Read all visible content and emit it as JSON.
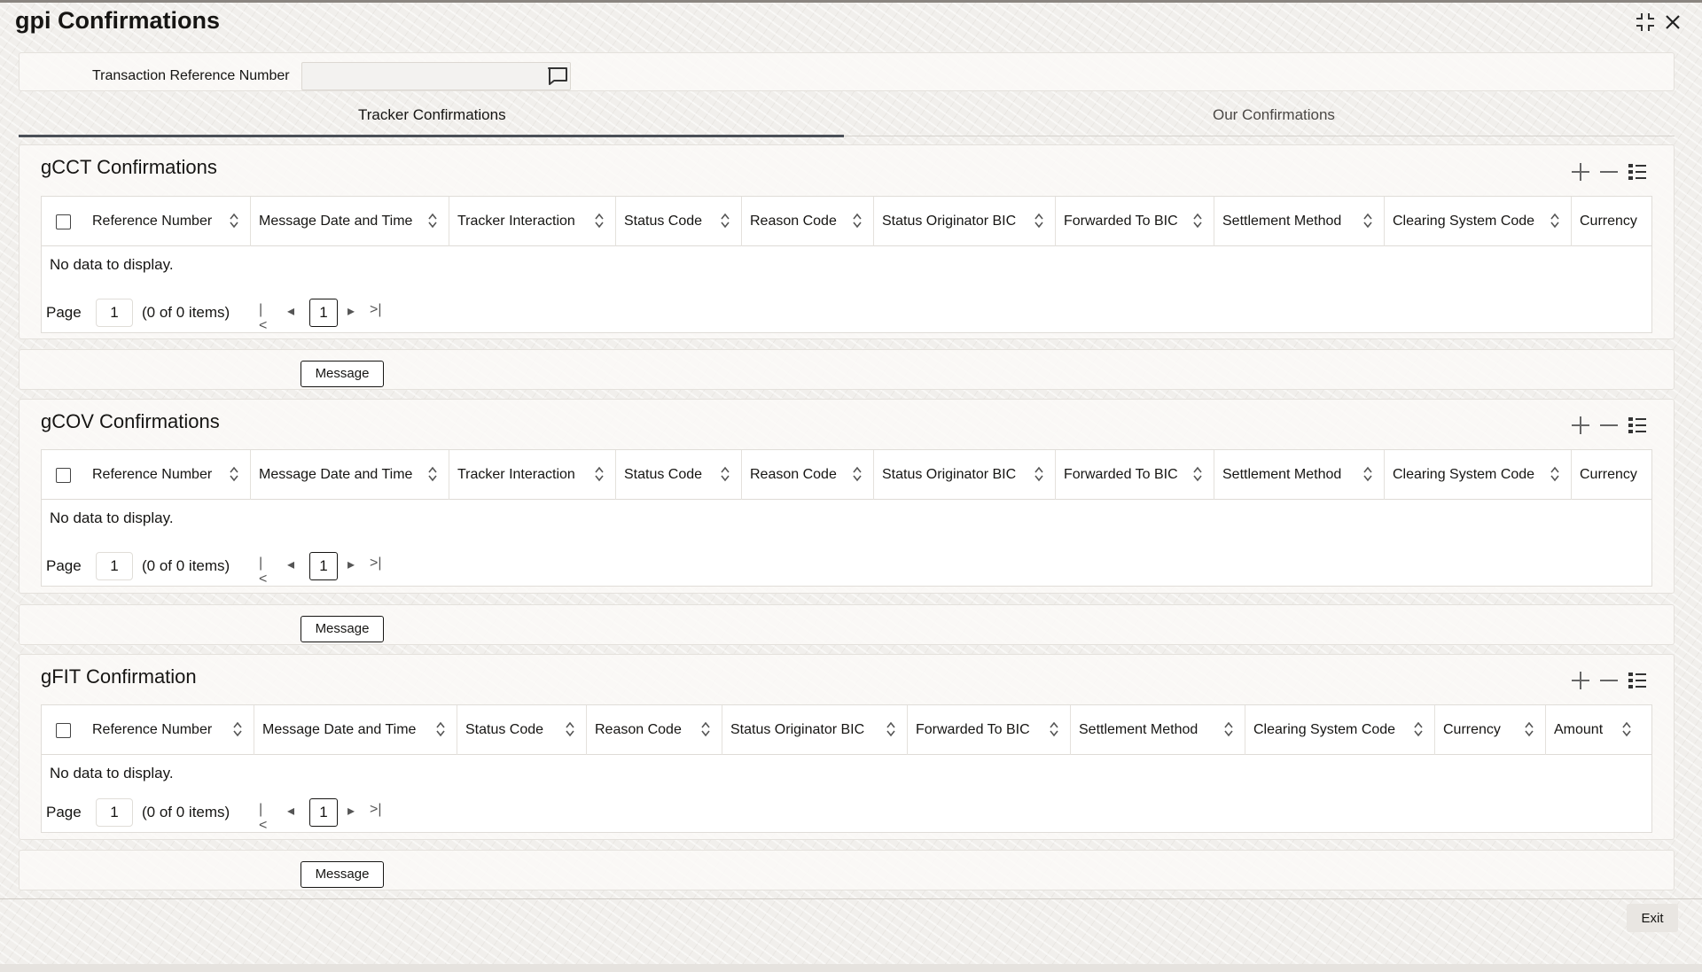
{
  "window": {
    "title": "gpi Confirmations",
    "restore_icon": "collapse-icon",
    "close_icon": "close-icon"
  },
  "transaction": {
    "label": "Transaction Reference Number",
    "value": "",
    "lookup_icon": "comment-icon"
  },
  "tabs": [
    {
      "label": "Tracker Confirmations",
      "active": true
    },
    {
      "label": "Our Confirmations",
      "active": false
    }
  ],
  "sections": [
    {
      "title": "gCCT Confirmations",
      "columns": [
        "Reference Number",
        "Message Date and Time",
        "Tracker Interaction",
        "Status Code",
        "Reason Code",
        "Status Originator BIC",
        "Forwarded To BIC",
        "Settlement Method",
        "Clearing System Code",
        "Currency"
      ],
      "no_data": "No data to display.",
      "pager": {
        "label": "Page",
        "page": "1",
        "count": "(0 of 0 items)",
        "current": "1"
      },
      "button": "Message"
    },
    {
      "title": "gCOV Confirmations",
      "columns": [
        "Reference Number",
        "Message Date and Time",
        "Tracker Interaction",
        "Status Code",
        "Reason Code",
        "Status Originator BIC",
        "Forwarded To BIC",
        "Settlement Method",
        "Clearing System Code",
        "Currency"
      ],
      "no_data": "No data to display.",
      "pager": {
        "label": "Page",
        "page": "1",
        "count": "(0 of 0 items)",
        "current": "1"
      },
      "button": "Message"
    },
    {
      "title": "gFIT Confirmation",
      "columns": [
        "Reference Number",
        "Message Date and Time",
        "Status Code",
        "Reason Code",
        "Status Originator BIC",
        "Forwarded To BIC",
        "Settlement Method",
        "Clearing System Code",
        "Currency",
        "Amount"
      ],
      "no_data": "No data to display.",
      "pager": {
        "label": "Page",
        "page": "1",
        "count": "(0 of 0 items)",
        "current": "1"
      },
      "button": "Message"
    }
  ],
  "footer": {
    "exit_label": "Exit"
  }
}
